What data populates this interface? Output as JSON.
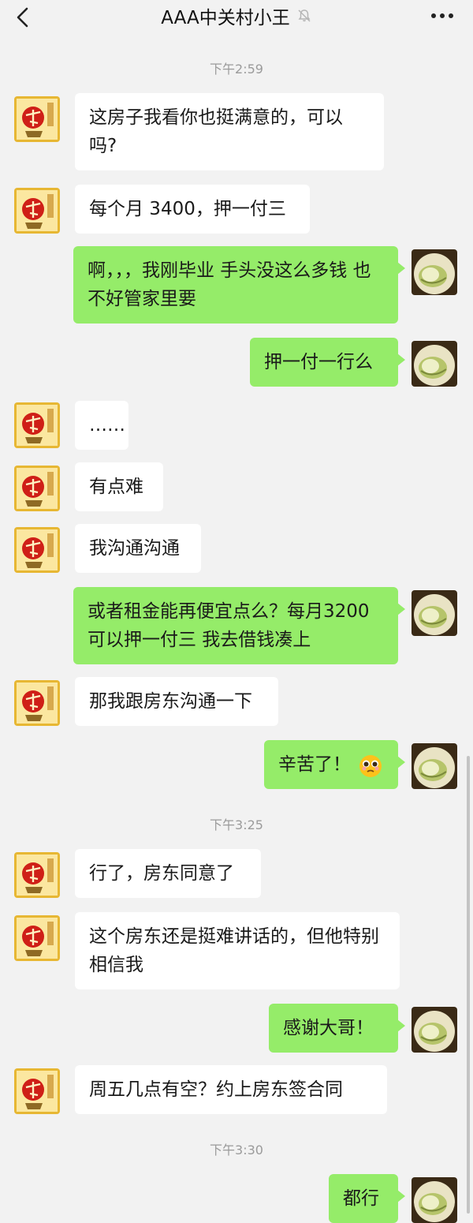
{
  "header": {
    "title": "AAA中关村小王",
    "back_icon": "chevron-left-icon",
    "mute_icon": "bell-off-icon",
    "more_icon": "more-dots-icon"
  },
  "times": [
    "下午2:59",
    "下午3:25",
    "下午3:30"
  ],
  "messages": [
    {
      "side": "in",
      "text": "这房子我看你也挺满意的，可以吗?"
    },
    {
      "side": "in",
      "text": "每个月 3400，押一付三"
    },
    {
      "side": "out",
      "text": "啊，，，我刚毕业 手头没这么多钱 也不好管家里要"
    },
    {
      "side": "out",
      "text": "押一付一行么"
    },
    {
      "side": "in",
      "text": "……"
    },
    {
      "side": "in",
      "text": "有点难"
    },
    {
      "side": "in",
      "text": "我沟通沟通"
    },
    {
      "side": "out",
      "text": "或者租金能再便宜点么？每月3200 可以押一付三 我去借钱凑上"
    },
    {
      "side": "in",
      "text": "那我跟房东沟通一下"
    },
    {
      "side": "out",
      "text": "辛苦了！",
      "emoji": "pleading-face-emoji"
    },
    {
      "side": "in",
      "text": "行了，房东同意了"
    },
    {
      "side": "in",
      "text": "这个房东还是挺难讲话的，但他特别相信我"
    },
    {
      "side": "out",
      "text": "感谢大哥！"
    },
    {
      "side": "in",
      "text": "周五几点有空？约上房东签合同"
    },
    {
      "side": "out",
      "text": "都行"
    }
  ],
  "colors": {
    "background": "#f2f2f2",
    "incoming_bubble": "#ffffff",
    "outgoing_bubble": "#95ec69",
    "timestamp": "#9b9b9b"
  }
}
